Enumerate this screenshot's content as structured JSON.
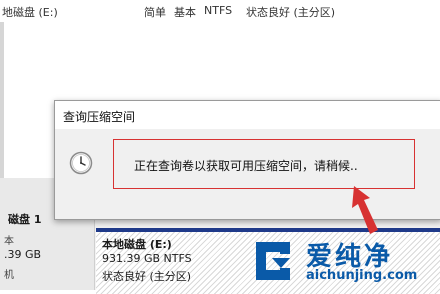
{
  "background_row": {
    "col1": "地磁盘 (E:)",
    "col2": "简单",
    "col3": "基本",
    "col4": "NTFS",
    "col5": "状态良好 (主分区)"
  },
  "disk": {
    "title": "磁盘 1",
    "mark1": "本",
    "size": ".39 GB",
    "mark2": "机"
  },
  "partition": {
    "name": "本地磁盘 (E:)",
    "size": "931.39 GB NTFS",
    "status": "状态良好 (主分区)"
  },
  "dialog": {
    "title": "查询压缩空间",
    "message": "正在查询卷以获取可用压缩空间，请稍候..",
    "icon": "clock-icon"
  },
  "watermark": {
    "brand": "爱纯净",
    "url": "aichunjing.com"
  },
  "colors": {
    "accent_red": "#d73232",
    "partition_header": "#1f3a8a",
    "brand_blue": "#0a5aa8"
  }
}
